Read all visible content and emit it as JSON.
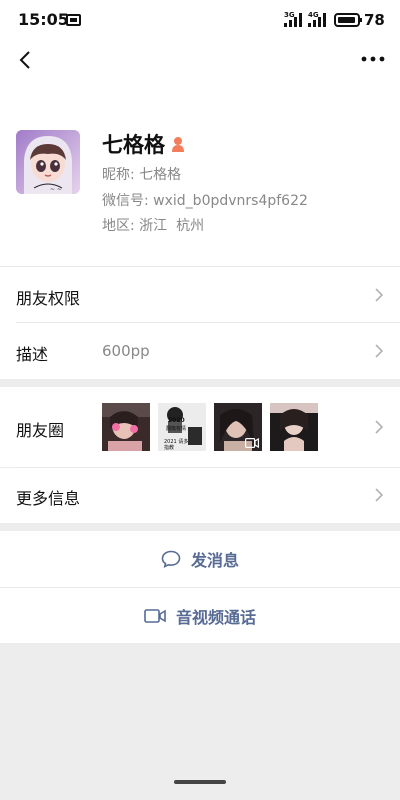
{
  "status_bar": {
    "time": "15:05",
    "signal_1_label": "3G",
    "signal_2_label": "4G",
    "battery": "78"
  },
  "profile": {
    "display_name": "七格格",
    "nickname_label": "昵称:",
    "nickname": "七格格",
    "wechat_id_label": "微信号:",
    "wechat_id": "wxid_b0pdvnrs4pf622",
    "region_label": "地区:",
    "region": "浙江  杭州",
    "gender_icon": "female-person-icon",
    "gender_color": "#f37e5b"
  },
  "rows": {
    "friend_permissions": "朋友权限",
    "description_label": "描述",
    "description_value": "600pp",
    "moments_label": "朋友圈",
    "more_info": "更多信息"
  },
  "moments_thumbs": [
    {
      "name": "moment-photo-1",
      "colors": [
        "#d9a2a6",
        "#3a2a2a"
      ],
      "has_video": false
    },
    {
      "name": "moment-photo-2",
      "caption_top": "2020",
      "caption_mid": "翻篇有情",
      "caption_bottom": "2021 请多指教",
      "has_video": false
    },
    {
      "name": "moment-photo-3",
      "colors": [
        "#c9b0a5",
        "#2b2527"
      ],
      "has_video": true
    },
    {
      "name": "moment-photo-4",
      "colors": [
        "#d8c4c0",
        "#1d1a1b"
      ],
      "has_video": false
    }
  ],
  "actions": {
    "send_message": "发消息",
    "video_call": "音视频通话"
  },
  "colors": {
    "link": "#576b95",
    "background": "#ededed"
  }
}
